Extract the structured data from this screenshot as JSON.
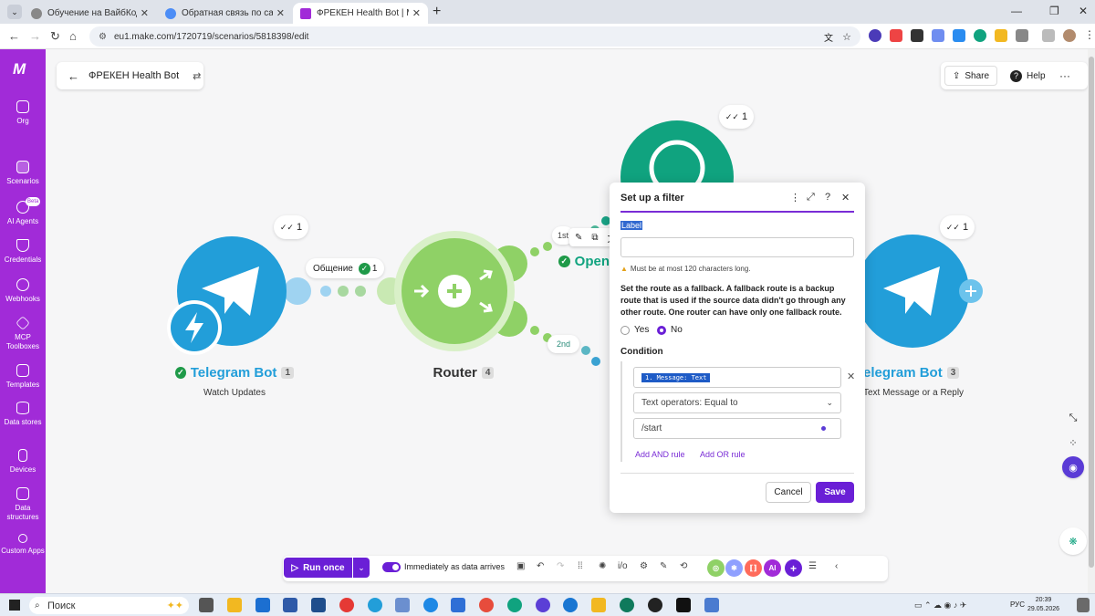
{
  "browser": {
    "tabs": [
      {
        "title": "Обучение на ВайбКодере",
        "active": false
      },
      {
        "title": "Обратная связь по сайту и об",
        "active": false
      },
      {
        "title": "ФРЕКЕН Health Bot | Make",
        "active": true
      }
    ],
    "url": "eu1.make.com/1720719/scenarios/5818398/edit"
  },
  "sidebar": {
    "logo": "M",
    "items": [
      {
        "label": "Org",
        "icon": "home-icon"
      },
      {
        "label": "Scenarios",
        "icon": "scenarios-icon",
        "active": true
      },
      {
        "label": "AI Agents",
        "icon": "ai-agents-icon",
        "badge": "Beta"
      },
      {
        "label": "Credentials",
        "icon": "shield-icon"
      },
      {
        "label": "Webhooks",
        "icon": "globe-icon"
      },
      {
        "label": "MCP Toolboxes",
        "icon": "mcp-icon"
      },
      {
        "label": "Templates",
        "icon": "puzzle-icon"
      },
      {
        "label": "Data stores",
        "icon": "database-icon"
      },
      {
        "label": "Devices",
        "icon": "device-icon"
      },
      {
        "label": "Data structures",
        "icon": "cube-icon"
      },
      {
        "label": "Custom Apps",
        "icon": "custom-apps-icon"
      }
    ]
  },
  "header": {
    "scenario_name": "ФРЕКЕН Health Bot",
    "share_label": "Share",
    "help_label": "Help"
  },
  "canvas": {
    "op_counts": {
      "telegram": "1",
      "openai": "1",
      "telegram_reply": "1"
    },
    "route_label": "Общение",
    "route_count": "1",
    "first_route": "1st",
    "second_route": "2nd",
    "modules": [
      {
        "name": "Telegram Bot",
        "number": "1",
        "subtitle": "Watch Updates"
      },
      {
        "name": "Router",
        "number": "4"
      },
      {
        "name": "Open"
      },
      {
        "name": "elegram Bot",
        "number": "3",
        "subtitle": "Text Message or a Reply"
      }
    ]
  },
  "filter_dialog": {
    "title": "Set up a filter",
    "label_field_label": "Label",
    "label_value": "",
    "warning": "Must be at most 120 characters long.",
    "fallback_text": "Set the route as a fallback. A fallback route is a backup route that is used if the source data didn't go through any other route. One router can have only one fallback route.",
    "yes_label": "Yes",
    "no_label": "No",
    "fallback_selected": "No",
    "condition_label": "Condition",
    "condition_field": "1. Message: Text",
    "operator": "Text operators: Equal to",
    "value": "/start",
    "add_and": "Add AND rule",
    "add_or": "Add OR rule",
    "cancel_label": "Cancel",
    "save_label": "Save"
  },
  "toolbar": {
    "run_once_label": "Run once",
    "schedule_label": "Immediately as data arrives",
    "ai_label": "AI"
  },
  "taskbar": {
    "search_label": "Поиск",
    "lang": "РУС",
    "time": "20:39",
    "date": "29.05.2026"
  },
  "colors": {
    "brand": "#a12bd8",
    "primary": "#6a1fd6",
    "telegram": "#229ed9",
    "router": "#8fd166",
    "openai": "#10a37f"
  }
}
